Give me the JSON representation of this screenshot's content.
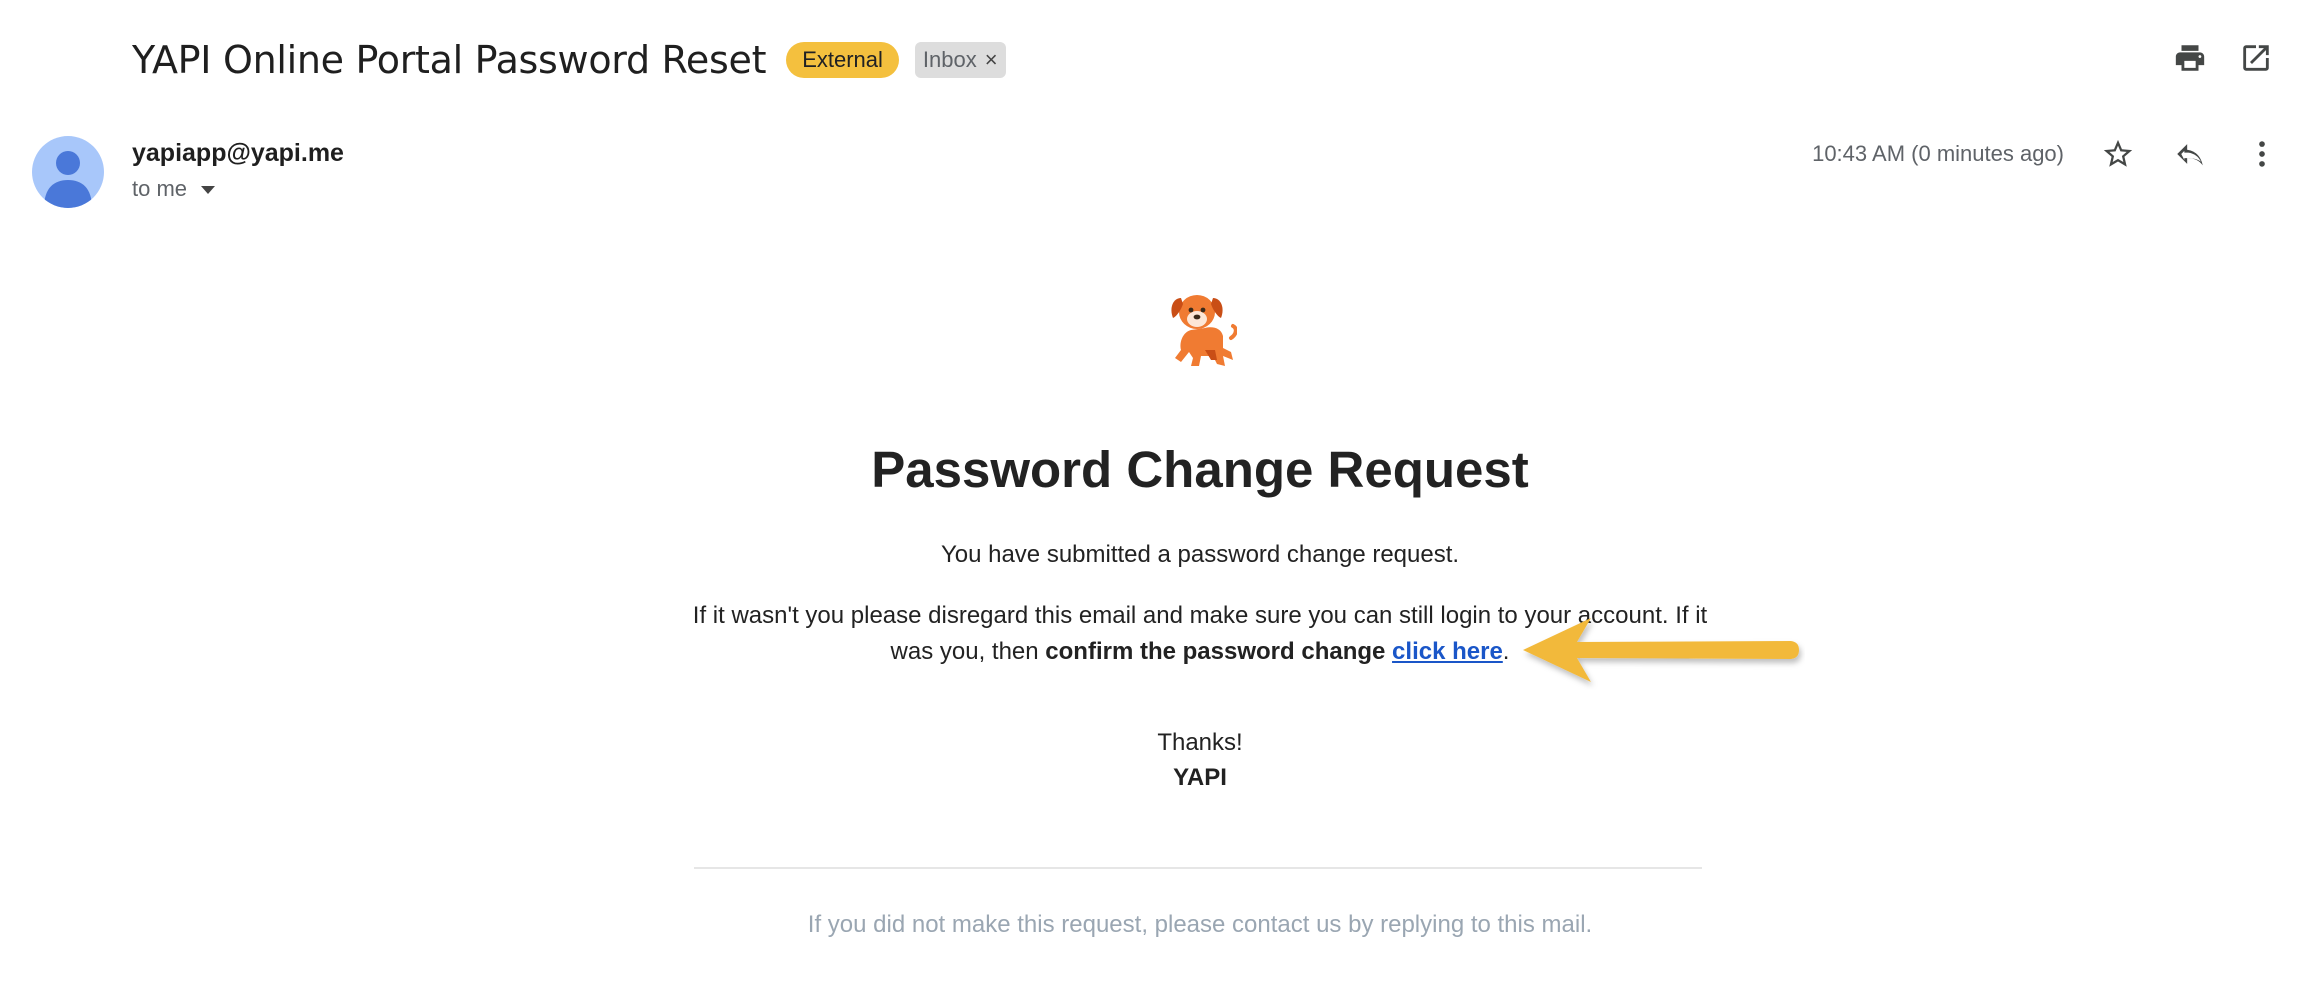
{
  "header": {
    "subject": "YAPI Online Portal Password Reset",
    "badge_external": "External",
    "badge_inbox": "Inbox",
    "badge_inbox_remove": "×",
    "actions": [
      "print-icon",
      "open-in-new-window-icon"
    ]
  },
  "sender": {
    "email": "yapiapp@yapi.me",
    "recipient": "to me",
    "timestamp": "10:43 AM (0 minutes ago)",
    "actions": [
      "star-icon",
      "reply-icon",
      "more-vert-icon"
    ]
  },
  "message": {
    "logo_icon": "dog-icon",
    "headline": "Password Change Request",
    "intro": "You have submitted a password change request.",
    "para_start": "If it wasn't you please disregard this email and make sure you can still login to your account. If it was you, then ",
    "para_bold": "confirm the password change",
    "link_text": "click here",
    "para_end": ".",
    "thanks": "Thanks!",
    "signature": "YAPI",
    "footer": "If you did not make this request, please contact us by replying to this mail."
  },
  "annotation": {
    "arrow_icon": "yellow-arrow-icon",
    "arrow_color": "#f2b93b"
  },
  "colors": {
    "external_badge": "#f4c03e",
    "inbox_badge": "#dddddd",
    "link": "#1a56c8",
    "avatar_bg": "#a8c7fa",
    "avatar_fg": "#4a78d9"
  }
}
